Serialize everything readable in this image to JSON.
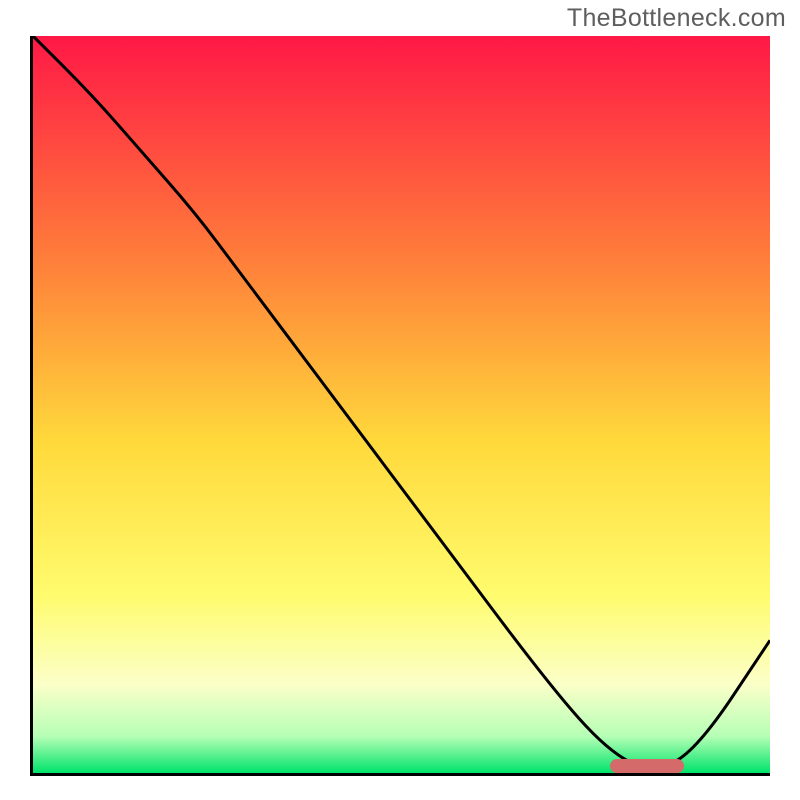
{
  "watermark": "TheBottleneck.com",
  "chart_data": {
    "type": "line",
    "title": "",
    "xlabel": "",
    "ylabel": "",
    "xlim": [
      0,
      100
    ],
    "ylim": [
      0,
      100
    ],
    "grid": false,
    "background": {
      "type": "vertical-gradient",
      "stops": [
        {
          "pos": 0,
          "color": "#ff1846"
        },
        {
          "pos": 30,
          "color": "#ff7d3a"
        },
        {
          "pos": 55,
          "color": "#ffd93b"
        },
        {
          "pos": 76,
          "color": "#fffc6e"
        },
        {
          "pos": 88,
          "color": "#fbffc8"
        },
        {
          "pos": 95,
          "color": "#b6ffb6"
        },
        {
          "pos": 100,
          "color": "#00e36a"
        }
      ]
    },
    "series": [
      {
        "name": "bottleneck-curve",
        "color": "#000000",
        "x": [
          0,
          8,
          15,
          22,
          28,
          40,
          55,
          70,
          78,
          84,
          90,
          100
        ],
        "y": [
          100,
          92,
          84,
          76,
          68,
          52,
          32,
          12,
          3,
          0,
          3,
          18
        ]
      }
    ],
    "marker": {
      "name": "optimal-range",
      "x_start": 78,
      "x_end": 88,
      "y": 0,
      "color": "#d46a6a"
    }
  }
}
